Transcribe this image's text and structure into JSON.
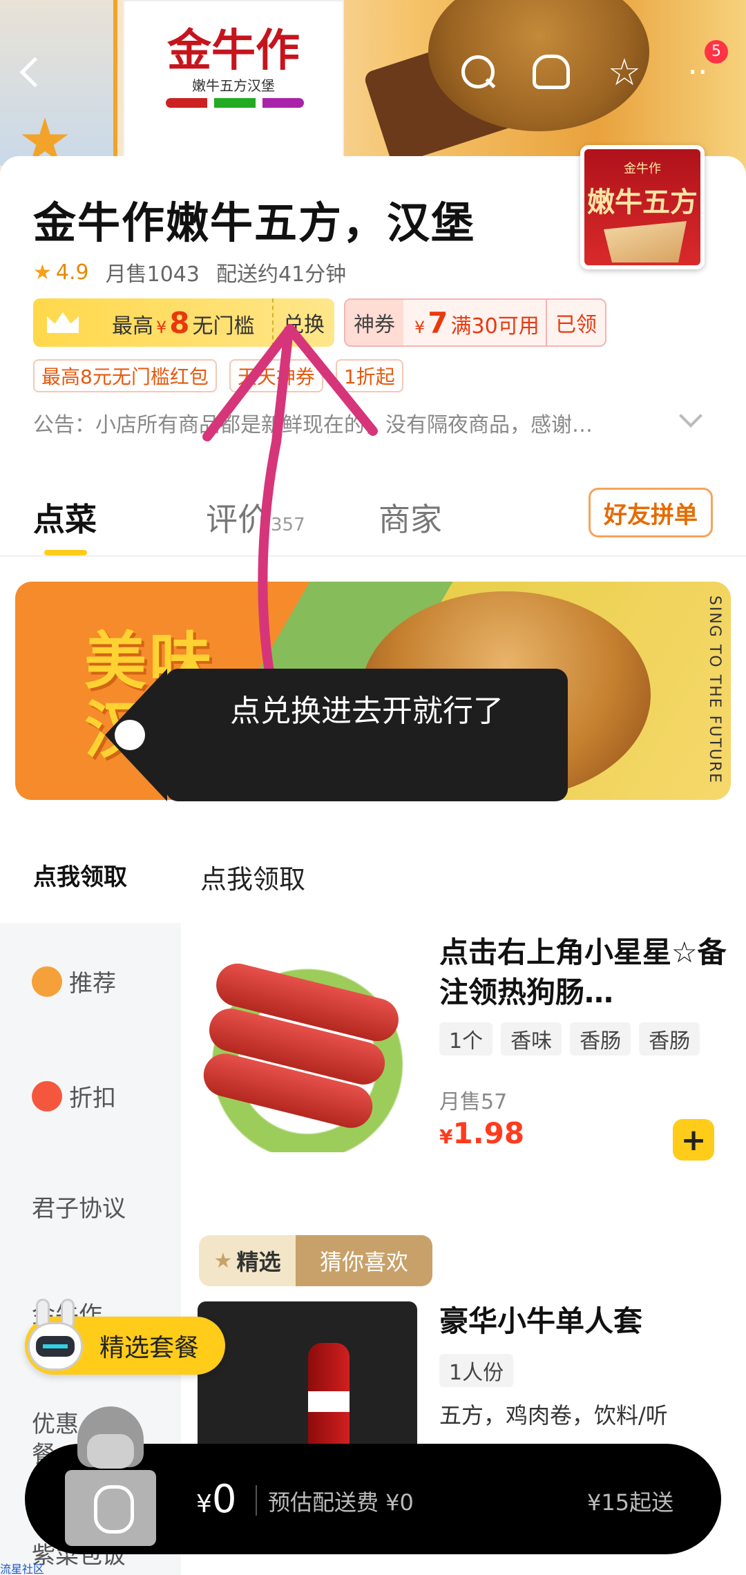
{
  "hero": {
    "poster_brand": "金牛作",
    "poster_sub": "嫩牛五方汉堡",
    "cart_badge": "5",
    "fav_glyph": "☆"
  },
  "store": {
    "name": "金牛作嫩牛五方，汉堡",
    "logo_mini": "金牛作",
    "logo_big": "嫩牛五方",
    "rating": "4.9",
    "monthly_sales": "月售1043",
    "delivery_time": "配送约41分钟"
  },
  "coupons": {
    "vip": {
      "prefix": "最高",
      "currency": "¥",
      "amount": "8",
      "suffix": "无门槛",
      "action": "兑换"
    },
    "god": {
      "tag": "神券",
      "currency": "¥",
      "amount": "7",
      "condition": "满30可用",
      "status": "已领"
    },
    "promos": [
      "最高8元无门槛红包",
      "天天神券",
      "1折起"
    ]
  },
  "notice": "公告：小店所有商品都是新鲜现在的，没有隔夜商品，感谢…",
  "annotation": {
    "tooltip": "点兑换进去开就行了"
  },
  "tabs": {
    "items": [
      {
        "label": "点菜"
      },
      {
        "label": "评价",
        "count": "357"
      },
      {
        "label": "商家"
      }
    ],
    "group_order": "好友拼单"
  },
  "banner": {
    "title_line1": "美味",
    "title_line2": "汉堡",
    "slogan": "SING TO THE FUTURE"
  },
  "menu": {
    "active_category": "点我领取",
    "section_title": "点我领取",
    "sidebar": [
      {
        "label": "推荐",
        "icon": "recommend-icon"
      },
      {
        "label": "折扣",
        "icon": "discount-icon"
      },
      {
        "label": "君子协议"
      },
      {
        "label": "金牛作"
      },
      {
        "label": "优惠，套餐"
      },
      {
        "label": "紫菜包饭"
      }
    ],
    "products": [
      {
        "name": "点击右上角小星星☆备注领热狗肠…",
        "tags": [
          "1个",
          "香味",
          "香肠",
          "香肠"
        ],
        "sales": "月售57",
        "currency": "¥",
        "price": "1.98"
      },
      {
        "badge_left": "精选",
        "badge_right": "猜你喜欢",
        "name": "豪华小牛单人套",
        "tags": [
          "1人份"
        ],
        "desc": "五方，鸡肉卷，饮料/听"
      }
    ]
  },
  "floating": {
    "set_meal": "精选套餐"
  },
  "cart": {
    "currency": "¥",
    "total": "0",
    "delivery_fee": "预估配送费 ¥0",
    "min_order": "¥15起送"
  },
  "watermark": "流星社区",
  "colors": {
    "accent": "#ffcc1a",
    "price": "#ff3b1f",
    "annotation": "#d6357a"
  }
}
